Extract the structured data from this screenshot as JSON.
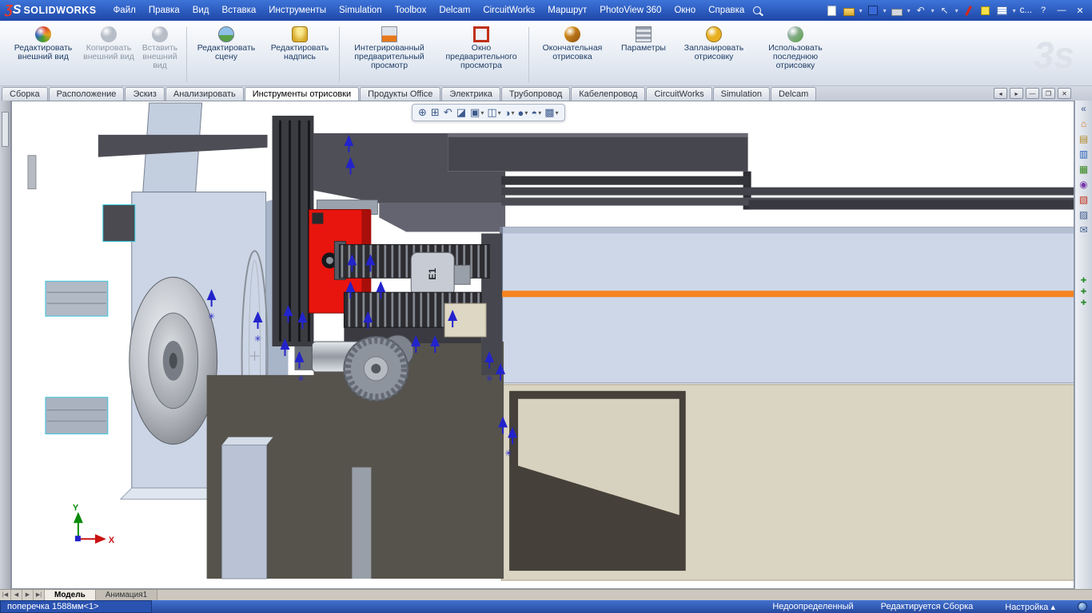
{
  "titlebar": {
    "logo_mark_red": "Ʒ",
    "logo_mark_white": "S",
    "logo_name": "SOLIDWORKS",
    "menus": [
      "Файл",
      "Правка",
      "Вид",
      "Вставка",
      "Инструменты",
      "Simulation",
      "Toolbox",
      "Delcam",
      "CircuitWorks",
      "Маршрут",
      "PhotoView 360",
      "Окно",
      "Справка"
    ],
    "command_text": "c...",
    "window_controls": {
      "help": "?",
      "minimize": "—",
      "close": "✕"
    }
  },
  "ribbon": {
    "watermark": "3s",
    "buttons": [
      {
        "label": "Редактировать внешний вид"
      },
      {
        "label": "Копировать внешний вид"
      },
      {
        "label": "Вставить внешний вид"
      },
      {
        "label": "Редактировать сцену"
      },
      {
        "label": "Редактировать надпись"
      },
      {
        "label": "Интегрированный предварительный просмотр"
      },
      {
        "label": "Окно предварительного просмотра"
      },
      {
        "label": "Окончательная отрисовка"
      },
      {
        "label": "Параметры"
      },
      {
        "label": "Запланировать отрисовку"
      },
      {
        "label": "Использовать последнюю отрисовку"
      }
    ]
  },
  "tabs": {
    "items": [
      "Сборка",
      "Расположение",
      "Эскиз",
      "Анализировать",
      "Инструменты отрисовки",
      "Продукты Office",
      "Электрика",
      "Трубопровод",
      "Кабелепровод",
      "CircuitWorks",
      "Simulation",
      "Delcam"
    ],
    "active": "Инструменты отрисовки"
  },
  "doc_window_controls": [
    "◂",
    "▸",
    "—",
    "❐",
    "✕"
  ],
  "viewport_toolbar": {
    "icons": [
      {
        "name": "zoom-fit",
        "glyph": "⊕",
        "arrow": ""
      },
      {
        "name": "zoom-to-area",
        "glyph": "⊞",
        "arrow": ""
      },
      {
        "name": "zoom-previous",
        "glyph": "↶",
        "arrow": ""
      },
      {
        "name": "section-view",
        "glyph": "◪",
        "arrow": ""
      },
      {
        "name": "view-orientation",
        "glyph": "▣",
        "arrow": "▾"
      },
      {
        "name": "display-style",
        "glyph": "◫",
        "arrow": "▾"
      },
      {
        "name": "hide-show-items",
        "glyph": "◑",
        "arrow": "▾"
      },
      {
        "name": "edit-appearance",
        "glyph": "●",
        "arrow": "▾"
      },
      {
        "name": "apply-scene",
        "glyph": "◓",
        "arrow": "▾"
      },
      {
        "name": "view-settings",
        "glyph": "▩",
        "arrow": "▾"
      }
    ]
  },
  "taskpane": {
    "icons": [
      {
        "glyph": "«"
      },
      {
        "glyph": "⌂"
      },
      {
        "glyph": "▤"
      },
      {
        "glyph": "▥"
      },
      {
        "glyph": "▦"
      },
      {
        "glyph": "◉"
      },
      {
        "glyph": "▧"
      },
      {
        "glyph": "▨"
      },
      {
        "glyph": "✉"
      }
    ],
    "more": [
      {
        "glyph": "✚"
      },
      {
        "glyph": "✚"
      },
      {
        "glyph": "✚"
      }
    ]
  },
  "viewport": {
    "labels": {
      "rack": "E1",
      "axis_x": "X",
      "axis_y": "Y"
    }
  },
  "doctabs": {
    "nav": [
      "|◀",
      "◀",
      "▶",
      "▶|"
    ],
    "tabs": [
      "Модель",
      "Анимация1"
    ],
    "active": "Модель"
  },
  "statusbar": {
    "selection": "поперечка 1588мм<1>",
    "state": "Недоопределенный",
    "mode": "Редактируется Сборка",
    "settings": "Настройка",
    "settings_arrow": "▴"
  }
}
